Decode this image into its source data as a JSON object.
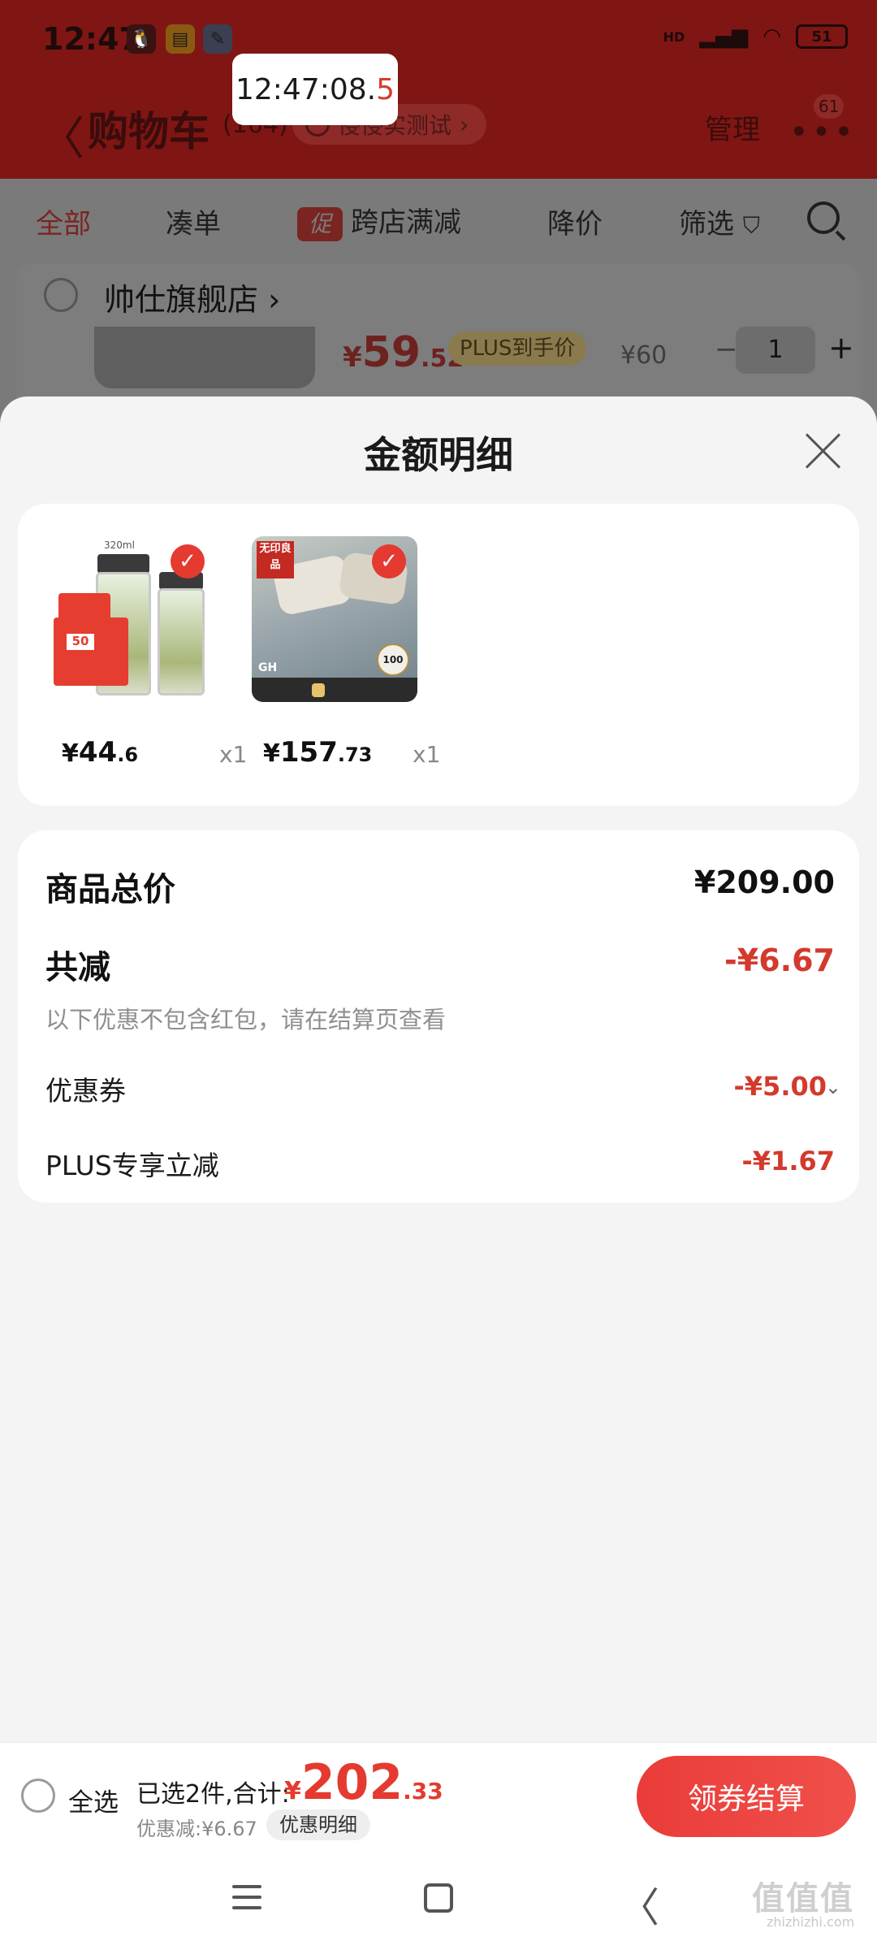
{
  "status_bar": {
    "time": "12:47",
    "battery": "51",
    "network": "HD"
  },
  "timestamp_overlay": {
    "main": "12:47:08.",
    "highlight": "5"
  },
  "header": {
    "back_glyph": "〈",
    "title": "购物车",
    "count": "(164)",
    "address": "侵侵实测试",
    "address_chevron": "›",
    "manage": "管理",
    "more_glyph": "•••",
    "more_badge": "61"
  },
  "filter_tabs": {
    "all": "全部",
    "combine": "凑单",
    "promo_badge": "促",
    "cross_store": "跨店满减",
    "price_drop": "降价",
    "filter": "筛选",
    "filter_glyph": "⛉"
  },
  "background_item": {
    "store_name": "帅仕旗舰店",
    "store_chevron": "›",
    "price_yen": "¥",
    "price_int": "59",
    "price_dec": ".52",
    "plus_tag": "PLUS到手价",
    "original_price": "¥60",
    "minus": "−",
    "quantity": "1",
    "plus": "+"
  },
  "sheet": {
    "title": "金额明细",
    "products": [
      {
        "name": "thermos-bottles",
        "yen": "¥",
        "int": "44",
        "dec": ".6",
        "qty": "x1",
        "image_text": {
          "capacity": "320ml",
          "promo": "50"
        }
      },
      {
        "name": "bedding-set",
        "yen": "¥",
        "int": "157",
        "dec": ".73",
        "qty": "x1",
        "image_text": {
          "brand": "无印良品",
          "seal": "100"
        }
      }
    ],
    "summary": {
      "total_label": "商品总价",
      "total_value": "¥209.00",
      "reduce_label": "共减",
      "reduce_value": "-¥6.67",
      "note": "以下优惠不包含红包，请在结算页查看",
      "coupon_label": "优惠券",
      "coupon_value": "-¥5.00",
      "coupon_chevron": "⌄",
      "plus_label": "PLUS专享立减",
      "plus_value": "-¥1.67"
    }
  },
  "checkout": {
    "select_all": "全选",
    "selected_text": "已选2件,合计:",
    "total_yen": "¥",
    "total_int": "202",
    "total_dec": ".33",
    "discount_text": "优惠减:¥6.67",
    "detail_button": "优惠明细",
    "checkout_button": "领券结算"
  },
  "nav": {
    "back_glyph": "〈"
  },
  "watermark": {
    "main": "值值值",
    "sub": "zhizhizhi.com"
  },
  "colors": {
    "header_red": "#7f1614",
    "accent_red": "#e43a30",
    "price_red": "#d33a2c"
  }
}
